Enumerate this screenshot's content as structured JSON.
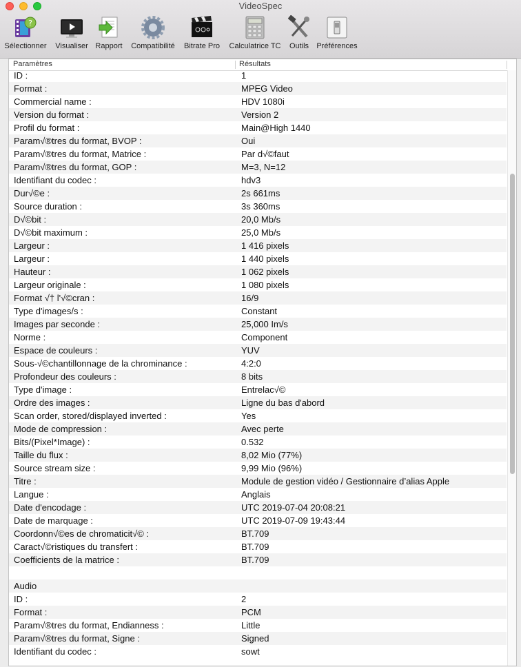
{
  "window": {
    "title": "VideoSpec"
  },
  "toolbar": [
    {
      "label": "Sélectionner",
      "icon": "film-select-icon"
    },
    {
      "label": "Visualiser",
      "icon": "monitor-icon"
    },
    {
      "label": "Rapport",
      "icon": "report-icon"
    },
    {
      "label": "Compatibilité",
      "icon": "gear-icon"
    },
    {
      "label": "Bitrate Pro",
      "icon": "clapperboard-icon"
    },
    {
      "label": "Calculatrice TC",
      "icon": "calculator-icon"
    },
    {
      "label": "Outils",
      "icon": "tools-icon"
    },
    {
      "label": "Préférences",
      "icon": "switch-icon"
    }
  ],
  "table": {
    "headers": [
      "Paramètres",
      "Résultats"
    ],
    "rows": [
      [
        "ID :",
        "1"
      ],
      [
        "Format :",
        "MPEG Video"
      ],
      [
        "Commercial name :",
        "HDV 1080i"
      ],
      [
        "Version du format :",
        "Version 2"
      ],
      [
        "Profil du format :",
        "Main@High 1440"
      ],
      [
        "Param√®tres du format, BVOP :",
        "Oui"
      ],
      [
        "Param√®tres du format, Matrice :",
        "Par d√©faut"
      ],
      [
        "Param√®tres du format, GOP :",
        "M=3, N=12"
      ],
      [
        "Identifiant du codec :",
        "hdv3"
      ],
      [
        "Dur√©e :",
        "2s 661ms"
      ],
      [
        "Source duration :",
        "3s 360ms"
      ],
      [
        "D√©bit :",
        "20,0 Mb/s"
      ],
      [
        "D√©bit maximum :",
        "25,0 Mb/s"
      ],
      [
        "Largeur :",
        "1 416 pixels"
      ],
      [
        "Largeur :",
        "1 440 pixels"
      ],
      [
        "Hauteur :",
        "1 062 pixels"
      ],
      [
        "Largeur originale :",
        "1 080 pixels"
      ],
      [
        "Format √† l'√©cran :",
        "16/9"
      ],
      [
        "Type d'images/s :",
        "Constant"
      ],
      [
        "Images par seconde :",
        "25,000 Im/s"
      ],
      [
        "Norme :",
        "Component"
      ],
      [
        "Espace de couleurs :",
        "YUV"
      ],
      [
        "Sous-√©chantillonnage de la chrominance :",
        "4:2:0"
      ],
      [
        "Profondeur des couleurs :",
        "8 bits"
      ],
      [
        "Type d'image :",
        "Entrelac√©"
      ],
      [
        "Ordre des images :",
        "Ligne du bas d'abord"
      ],
      [
        "Scan order, stored/displayed inverted :",
        "Yes"
      ],
      [
        "Mode de compression :",
        "Avec perte"
      ],
      [
        "Bits/(Pixel*Image) :",
        "0.532"
      ],
      [
        "Taille du flux :",
        "8,02 Mio (77%)"
      ],
      [
        "Source stream size :",
        "9,99 Mio (96%)"
      ],
      [
        "Titre :",
        "Module de gestion vidéo / Gestionnaire d’alias Apple"
      ],
      [
        "Langue :",
        "Anglais"
      ],
      [
        "Date d'encodage :",
        "UTC 2019-07-04 20:08:21"
      ],
      [
        "Date de marquage :",
        "UTC 2019-07-09 19:43:44"
      ],
      [
        "Coordonn√©es de chromaticit√© :",
        "BT.709"
      ],
      [
        "Caract√©ristiques du transfert :",
        "BT.709"
      ],
      [
        "Coefficients de la matrice :",
        "BT.709"
      ],
      [
        "",
        ""
      ],
      [
        "Audio",
        ""
      ],
      [
        "ID :",
        "2"
      ],
      [
        "Format :",
        "PCM"
      ],
      [
        "Param√®tres du format, Endianness :",
        "Little"
      ],
      [
        "Param√®tres du format, Signe :",
        "Signed"
      ],
      [
        "Identifiant du codec :",
        "sowt"
      ]
    ]
  }
}
